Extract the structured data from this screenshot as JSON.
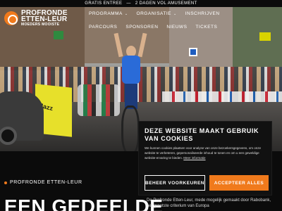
{
  "colors": {
    "accent": "#f07a1c",
    "background": "#0b0b0b",
    "text": "#ffffff"
  },
  "topbar": {
    "left": "GRATIS ENTREE",
    "right": "2 DAGEN VOL AMUSEMENT"
  },
  "logo": {
    "line1": "PROFRONDE",
    "line2": "ETTEN-LEUR",
    "line3": "MOEDERS MOOISTE",
    "icon": "wheel-logo-icon"
  },
  "nav": {
    "items": [
      {
        "label": "PROGRAMMA",
        "has_dropdown": true
      },
      {
        "label": "ORGANISATIE",
        "has_dropdown": true
      },
      {
        "label": "INSCHRIJVEN",
        "has_dropdown": false
      },
      {
        "label": "PARCOURS",
        "has_dropdown": false
      },
      {
        "label": "SPONSOREN",
        "has_dropdown": false
      },
      {
        "label": "NIEUWS",
        "has_dropdown": false
      },
      {
        "label": "TICKETS",
        "has_dropdown": false
      }
    ]
  },
  "hero": {
    "banner_text": "Jazz"
  },
  "section": {
    "label": "PROFRONDE ETTEN-LEUR",
    "title": "EEN GEDEELDE",
    "body": "De Profronde Etten-Leur, mede mogelijk gemaakt door Rabobank, het grootste criterium van Europa"
  },
  "cookie": {
    "title": "DEZE WEBSITE MAAKT GEBRUIK VAN COOKIES",
    "text": "We kunnen cookies plaatsen voor analyse van onze bezoekersgegevens, om onze website te verbeteren, gepersonaliseerde inhoud te tonen en om u een geweldige website-ervaring te bieden.",
    "more_link": "Meer informatie",
    "manage_button": "BEHEER VOORKEUREN",
    "accept_button": "ACCEPTEER ALLES"
  }
}
